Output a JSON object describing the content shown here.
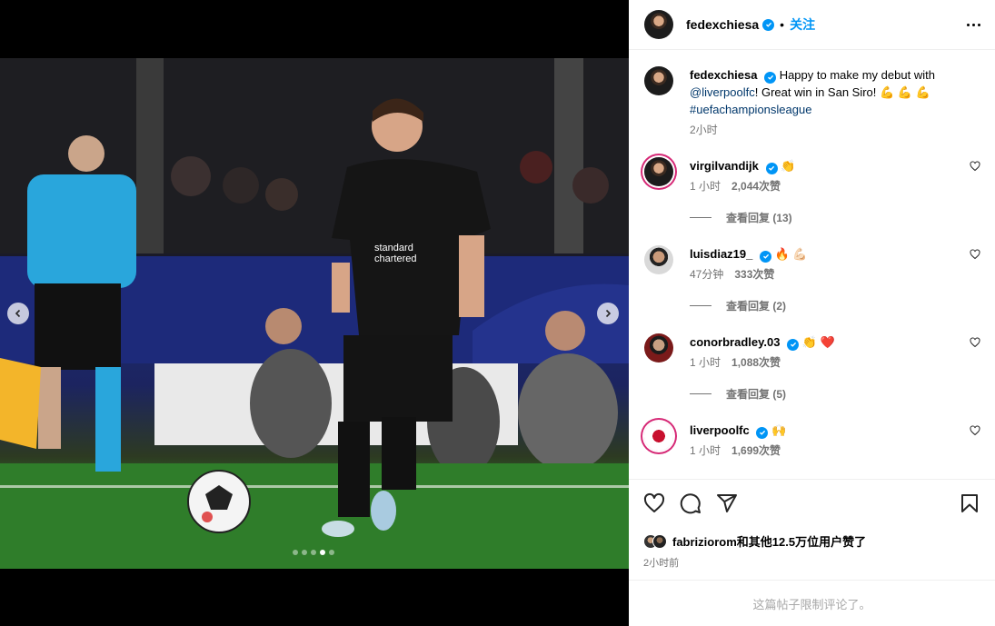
{
  "post": {
    "author": "fedexchiesa",
    "follow_label": "关注",
    "separator": "•",
    "caption": {
      "text_1": "Happy to make my debut with",
      "mention": "@liverpoolfc",
      "text_2": "! Great win in San Siro! 💪 💪 💪",
      "hashtag": "#uefachampionsleague",
      "time": "2小时"
    }
  },
  "comments": [
    {
      "user": "virgilvandijk",
      "text": "👏",
      "time": "1 小时",
      "likes": "2,044次赞",
      "replies": "查看回复 (13)"
    },
    {
      "user": "luisdiaz19_",
      "text": "🔥 💪🏻",
      "time": "47分钟",
      "likes": "333次赞",
      "replies": "查看回复 (2)"
    },
    {
      "user": "conorbradley.03",
      "text": "👏 ❤️",
      "time": "1 小时",
      "likes": "1,088次赞",
      "replies": "查看回复 (5)"
    },
    {
      "user": "liverpoolfc",
      "text": "🙌",
      "time": "1 小时",
      "likes": "1,699次赞"
    }
  ],
  "likes_summary": {
    "user": "fabriziorom",
    "rest": "和其他12.5万位用户赞了"
  },
  "post_time": "2小时前",
  "comments_limited": "这篇帖子限制评论了。",
  "carousel": {
    "count": 5,
    "active_index": 3
  },
  "colors": {
    "verified": "#0095f6",
    "follow": "#0095f6",
    "story_ring": "#d62976"
  }
}
